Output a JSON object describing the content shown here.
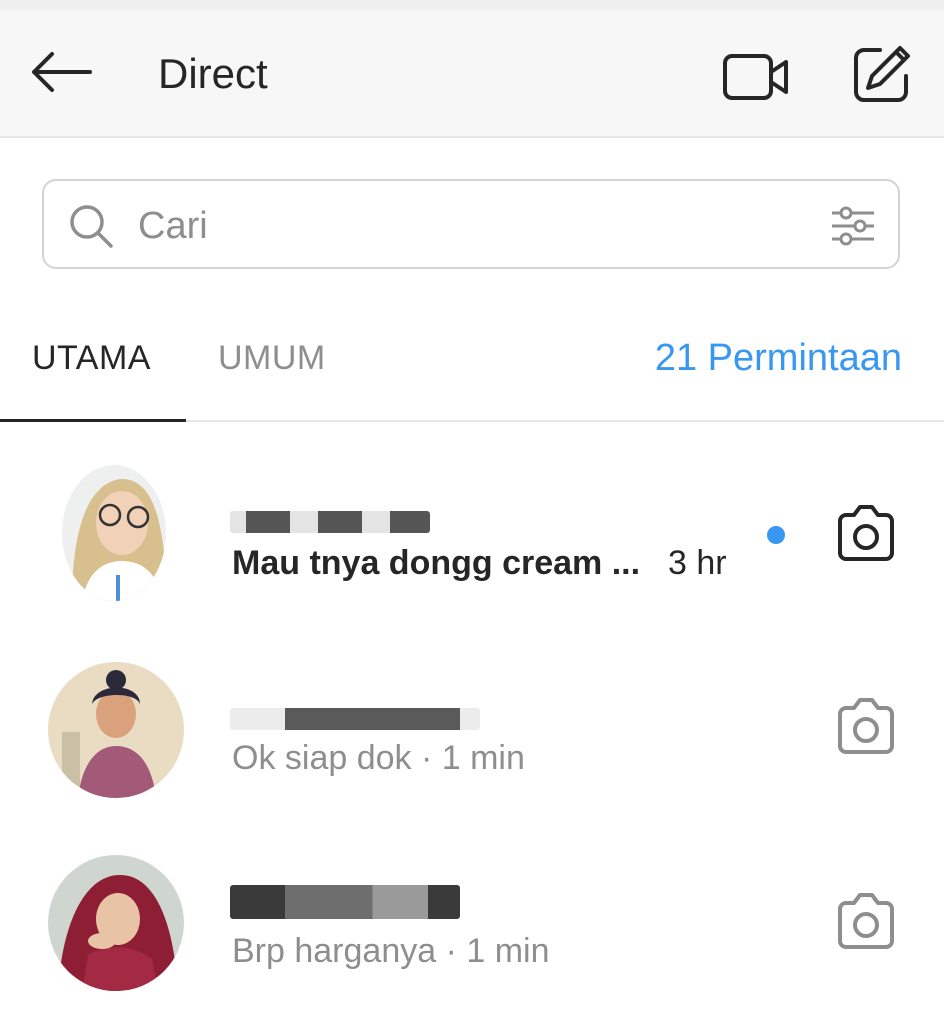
{
  "header": {
    "title": "Direct"
  },
  "search": {
    "placeholder": "Cari"
  },
  "tabs": {
    "primary": "UTAMA",
    "general": "UMUM",
    "requests": "21 Permintaan"
  },
  "threads": [
    {
      "message": "Mau tnya dongg cream ...",
      "time": "3 hr",
      "unread": true
    },
    {
      "message": "Ok siap dok · 1 min",
      "unread": false
    },
    {
      "message": "Brp harganya · 1 min",
      "unread": false
    }
  ],
  "colors": {
    "accent": "#3897f0",
    "text": "#262626",
    "muted": "#8e8e8e"
  }
}
